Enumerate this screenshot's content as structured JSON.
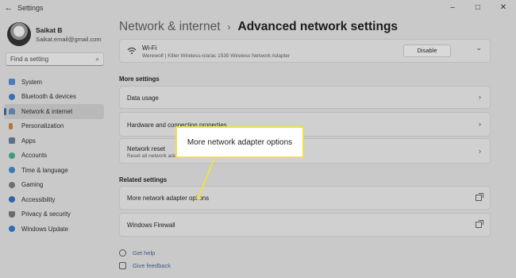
{
  "window": {
    "title": "Settings",
    "back_glyph": "←",
    "minimize_glyph": "–",
    "maximize_glyph": "□",
    "close_glyph": "✕"
  },
  "user": {
    "name": "Saikat B",
    "email": "Saikat.email@gmail.com"
  },
  "search": {
    "placeholder": "Find a setting"
  },
  "sidebar": {
    "items": [
      {
        "label": "System",
        "icon": "monitor-icon",
        "color": "#4a7db8"
      },
      {
        "label": "Bluetooth & devices",
        "icon": "bluetooth-icon",
        "color": "#3a6fb0"
      },
      {
        "label": "Network & internet",
        "icon": "wifi-icon",
        "color": "#5a7fa8"
      },
      {
        "label": "Personalization",
        "icon": "brush-icon",
        "color": "#b5763a"
      },
      {
        "label": "Apps",
        "icon": "apps-icon",
        "color": "#5a6f88"
      },
      {
        "label": "Accounts",
        "icon": "person-icon",
        "color": "#3f9a7a"
      },
      {
        "label": "Time & language",
        "icon": "globe-icon",
        "color": "#3b78b8"
      },
      {
        "label": "Gaming",
        "icon": "controller-icon",
        "color": "#6f6f6f"
      },
      {
        "label": "Accessibility",
        "icon": "accessibility-icon",
        "color": "#2f62a8"
      },
      {
        "label": "Privacy & security",
        "icon": "shield-icon",
        "color": "#6b6b6b"
      },
      {
        "label": "Windows Update",
        "icon": "refresh-icon",
        "color": "#2f6fb5"
      }
    ],
    "selected_index": 2
  },
  "header": {
    "breadcrumb": "Network & internet",
    "separator": "›",
    "title": "Advanced network settings"
  },
  "wifi": {
    "name": "Wi-Fi",
    "adapter": "Werewolf | Killer Wireless-n/a/ac 1535 Wireless Network Adapter",
    "disable_label": "Disable",
    "expand_glyph": "⌄"
  },
  "more_settings": {
    "title": "More settings",
    "items": [
      {
        "label": "Data usage",
        "sub": ""
      },
      {
        "label": "Hardware and connection properties",
        "sub": ""
      },
      {
        "label": "Network reset",
        "sub": "Reset all network adapters"
      }
    ]
  },
  "related_settings": {
    "title": "Related settings",
    "items": [
      {
        "label": "More network adapter options"
      },
      {
        "label": "Windows Firewall"
      }
    ]
  },
  "links": {
    "help": "Get help",
    "feedback": "Give feedback"
  },
  "callout": {
    "text": "More network adapter options",
    "border_color": "#f0e04a"
  },
  "chevron_glyph": "›",
  "search_glyph": "⌕"
}
